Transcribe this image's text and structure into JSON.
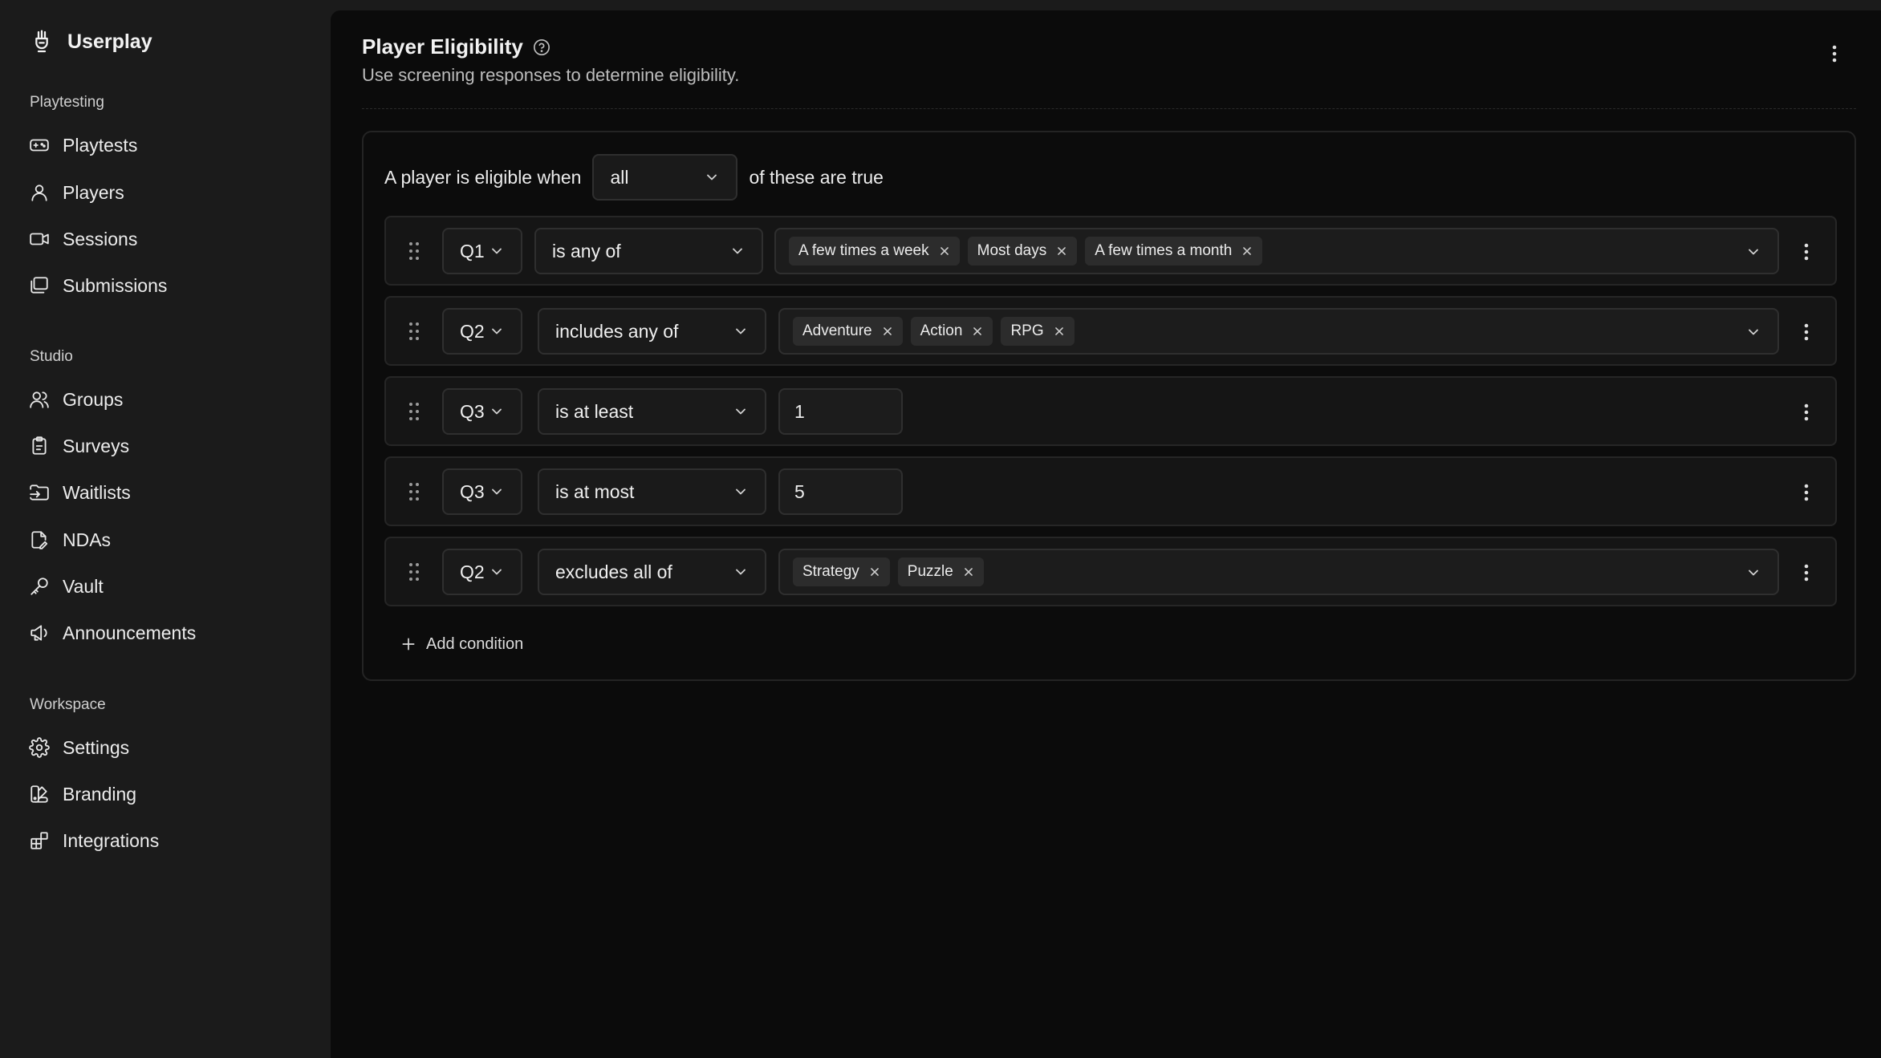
{
  "app": {
    "name": "Userplay"
  },
  "sidebar": {
    "sections": [
      {
        "label": "Playtesting",
        "items": [
          {
            "label": "Playtests",
            "icon": "gamepad-icon"
          },
          {
            "label": "Players",
            "icon": "user-icon"
          },
          {
            "label": "Sessions",
            "icon": "video-icon"
          },
          {
            "label": "Submissions",
            "icon": "gallery-icon"
          }
        ]
      },
      {
        "label": "Studio",
        "items": [
          {
            "label": "Groups",
            "icon": "users-icon"
          },
          {
            "label": "Surveys",
            "icon": "clipboard-icon"
          },
          {
            "label": "Waitlists",
            "icon": "folder-input-icon"
          },
          {
            "label": "NDAs",
            "icon": "file-pen-icon"
          },
          {
            "label": "Vault",
            "icon": "key-icon"
          },
          {
            "label": "Announcements",
            "icon": "megaphone-icon"
          }
        ]
      },
      {
        "label": "Workspace",
        "items": [
          {
            "label": "Settings",
            "icon": "gear-icon"
          },
          {
            "label": "Branding",
            "icon": "palette-icon"
          },
          {
            "label": "Integrations",
            "icon": "blocks-icon"
          }
        ]
      }
    ]
  },
  "page": {
    "title": "Player Eligibility",
    "subtitle": "Use screening responses to determine eligibility."
  },
  "rules": {
    "prefix": "A player is eligible when",
    "match_mode": "all",
    "suffix": "of these are true",
    "add_label": "Add condition",
    "conditions": [
      {
        "question": "Q1",
        "operator": "is any of",
        "values": [
          "A few times a week",
          "Most days",
          "A few times a month"
        ]
      },
      {
        "question": "Q2",
        "operator": "includes any of",
        "values": [
          "Adventure",
          "Action",
          "RPG"
        ]
      },
      {
        "question": "Q3",
        "operator": "is at least",
        "number": "1"
      },
      {
        "question": "Q3",
        "operator": "is at most",
        "number": "5"
      },
      {
        "question": "Q2",
        "operator": "excludes all of",
        "values": [
          "Strategy",
          "Puzzle"
        ]
      }
    ]
  },
  "colors": {
    "sidebar_bg": "#1b1b1b",
    "main_bg": "#0b0b0b",
    "chip_bg": "#2c2c2c",
    "text": "#ececec"
  }
}
